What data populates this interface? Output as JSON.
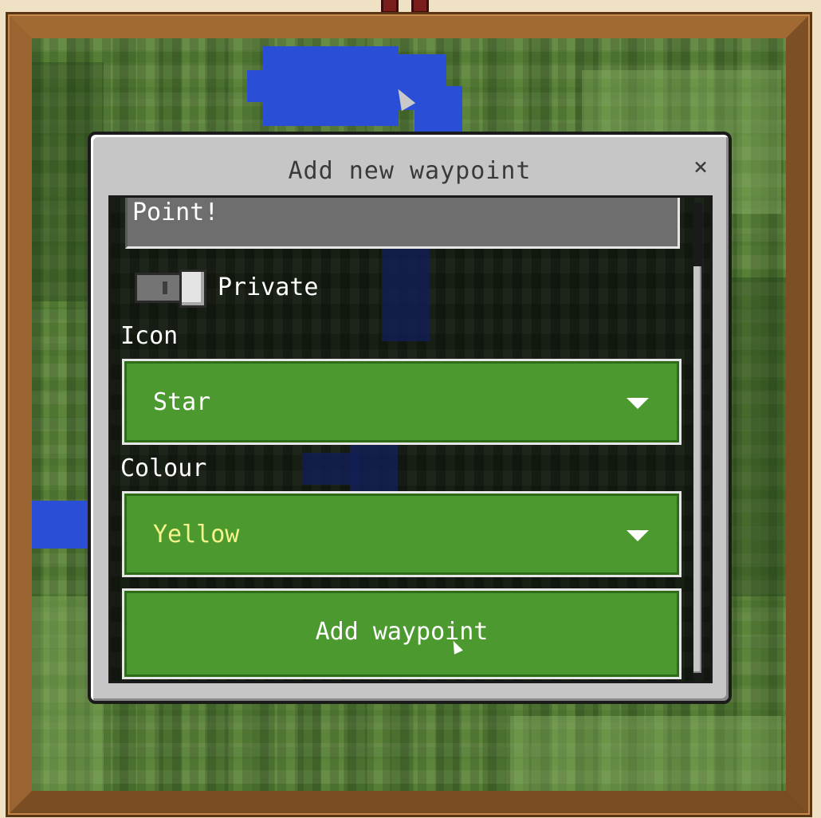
{
  "dialog": {
    "title": "Add new waypoint",
    "close_symbol": "×"
  },
  "name_field": {
    "value": "Point!"
  },
  "private_toggle": {
    "label": "Private",
    "state": "on"
  },
  "icon": {
    "label": "Icon",
    "selected": "Star"
  },
  "colour": {
    "label": "Colour",
    "selected": "Yellow",
    "text_color": "#f4f48a"
  },
  "submit": {
    "label": "Add waypoint"
  },
  "colors": {
    "button_green": "#4c9a2f",
    "frame_wood": "#8b5a2b",
    "dialog_grey": "#c6c6c6",
    "river_blue": "#2a4fd6"
  }
}
